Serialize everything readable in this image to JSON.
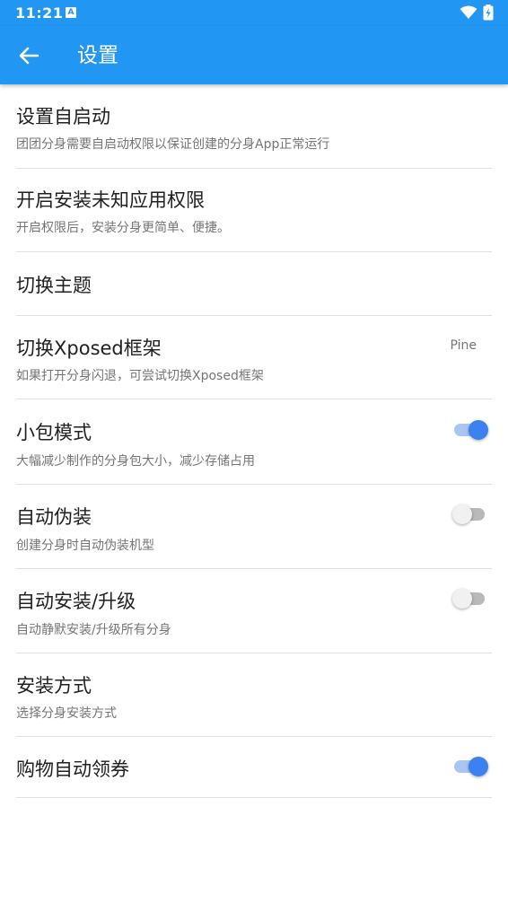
{
  "status_bar": {
    "time": "11:21",
    "notification_icon": "A",
    "wifi_icon": "wifi-icon",
    "battery_icon": "battery-charging-icon"
  },
  "app_bar": {
    "back_icon": "arrow-back-icon",
    "title": "设置"
  },
  "colors": {
    "primary": "#2196F3",
    "toggle_on": "#3b82f0",
    "toggle_off": "#f1f1f1"
  },
  "settings": {
    "items": [
      {
        "title": "设置自启动",
        "subtitle": "团团分身需要自启动权限以保证创建的分身App正常运行"
      },
      {
        "title": "开启安装未知应用权限",
        "subtitle": "开启权限后，安装分身更简单、便捷。"
      },
      {
        "title": "切换主题"
      },
      {
        "title": "切换Xposed框架",
        "subtitle": "如果打开分身闪退，可尝试切换Xposed框架",
        "value": "Pine"
      },
      {
        "title": "小包模式",
        "subtitle": "大幅减少制作的分身包大小，减少存储占用",
        "toggle": true
      },
      {
        "title": "自动伪装",
        "subtitle": "创建分身时自动伪装机型",
        "toggle": false
      },
      {
        "title": "自动安装/升级",
        "subtitle": "自动静默安装/升级所有分身",
        "toggle": false
      },
      {
        "title": "安装方式",
        "subtitle": "选择分身安装方式"
      },
      {
        "title": "购物自动领券",
        "toggle": true
      }
    ]
  }
}
